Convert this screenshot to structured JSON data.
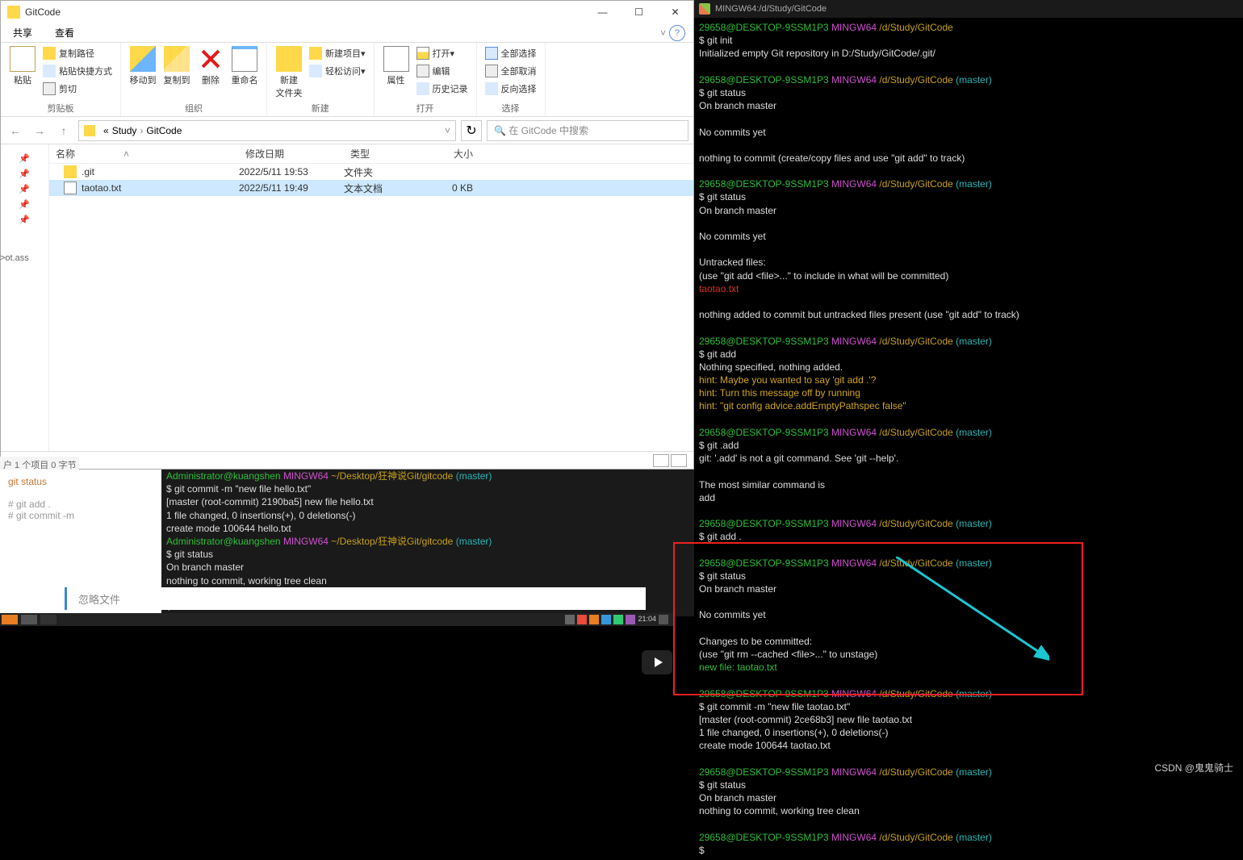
{
  "explorer": {
    "title": "GitCode",
    "tabs": {
      "share": "共享",
      "view": "查看"
    },
    "ribbon": {
      "clipboard": {
        "paste": "粘贴",
        "copy_path": "复制路径",
        "paste_shortcut": "粘贴快捷方式",
        "cut": "剪切",
        "group": "剪贴板"
      },
      "organize": {
        "move_to": "移动到",
        "copy_to": "复制到",
        "delete": "删除",
        "rename": "重命名",
        "group": "组织"
      },
      "new": {
        "new_folder_l1": "新建",
        "new_folder_l2": "文件夹",
        "new_item": "新建项目",
        "easy_access": "轻松访问",
        "group": "新建"
      },
      "open": {
        "properties": "属性",
        "open": "打开",
        "edit": "编辑",
        "history": "历史记录",
        "group": "打开"
      },
      "select": {
        "select_all": "全部选择",
        "select_none": "全部取消",
        "invert": "反向选择",
        "group": "选择"
      }
    },
    "breadcrumb": {
      "prefix": "«",
      "p1": "Study",
      "p2": "GitCode"
    },
    "search_placeholder": "在 GitCode 中搜索",
    "columns": {
      "name": "名称",
      "date": "修改日期",
      "type": "类型",
      "size": "大小"
    },
    "rows": [
      {
        "name": ".git",
        "date": "2022/5/11 19:53",
        "type": "文件夹",
        "size": ""
      },
      {
        "name": "taotao.txt",
        "date": "2022/5/11 19:49",
        "type": "文本文档",
        "size": "0 KB"
      }
    ],
    "status_ext": "户 1 个项目  0 字节",
    "potass": ">ot.ass"
  },
  "bgterm": {
    "side": {
      "gitstatus": "git status",
      "gitadd": "# git add .",
      "gitcommit": "# git commit -m",
      "ignore": "忽略文件"
    },
    "l0a": "Administrator@kuangshen",
    "l0b": "MINGW64",
    "l0c": "~/Desktop/狂神说Git/gitcode",
    "l0d": "(master)",
    "l1": "$ git commit -m \"new file hello.txt\"",
    "l2": "[master (root-commit) 2190ba5] new file hello.txt",
    "l3": " 1 file changed, 0 insertions(+), 0 deletions(-)",
    "l4": " create mode 100644 hello.txt",
    "l5": "$ git status",
    "l6": "On branch master",
    "l7": "nothing to commit, working tree clean",
    "l8": "$"
  },
  "taskbar": {
    "time": "21:04"
  },
  "gitbash": {
    "title": "MINGW64:/d/Study/GitCode",
    "prompt_user": "29658@DESKTOP-9SSM1P3",
    "prompt_host": "MINGW64",
    "prompt_path": "/d/Study/GitCode",
    "prompt_branch": "(master)",
    "t": {
      "init1": "$ git init",
      "init2": "Initialized empty Git repository in D:/Study/GitCode/.git/",
      "st": "$ git status",
      "onbranch": "On branch master",
      "nocommits": "No commits yet",
      "nothing": "nothing to commit (create/copy files and use \"git add\" to track)",
      "untracked": "Untracked files:",
      "use_add": "  (use \"git add <file>...\" to include in what will be committed)",
      "taotao": "        taotao.txt",
      "nothing_added": "nothing added to commit but untracked files present (use \"git add\" to track)",
      "gitadd": "$ git add",
      "nothing_spec": "Nothing specified, nothing added.",
      "hint1": "hint: Maybe you wanted to say 'git add .'?",
      "hint2": "hint: Turn this message off by running",
      "hint3": "hint: \"git config advice.addEmptyPathspec false\"",
      "git_dotadd": "$ git .add",
      "noterr": "git: '.add' is not a git command. See 'git --help'.",
      "similar1": "The most similar command is",
      "similar2": "        add",
      "git_add_dot": "$ git add .",
      "changes": "Changes to be committed:",
      "use_rm": "  (use \"git rm --cached <file>...\" to unstage)",
      "newfile": "        new file:   taotao.txt",
      "commit_cmd": "$ git commit -m \"new file taotao.txt\"",
      "commit_r1": "[master (root-commit) 2ce68b3] new file taotao.txt",
      "commit_r2": " 1 file changed, 0 insertions(+), 0 deletions(-)",
      "commit_r3": " create mode 100644 taotao.txt",
      "clean": "nothing to commit, working tree clean",
      "dollar": "$"
    }
  },
  "watermark": "CSDN @鬼鬼骑士"
}
